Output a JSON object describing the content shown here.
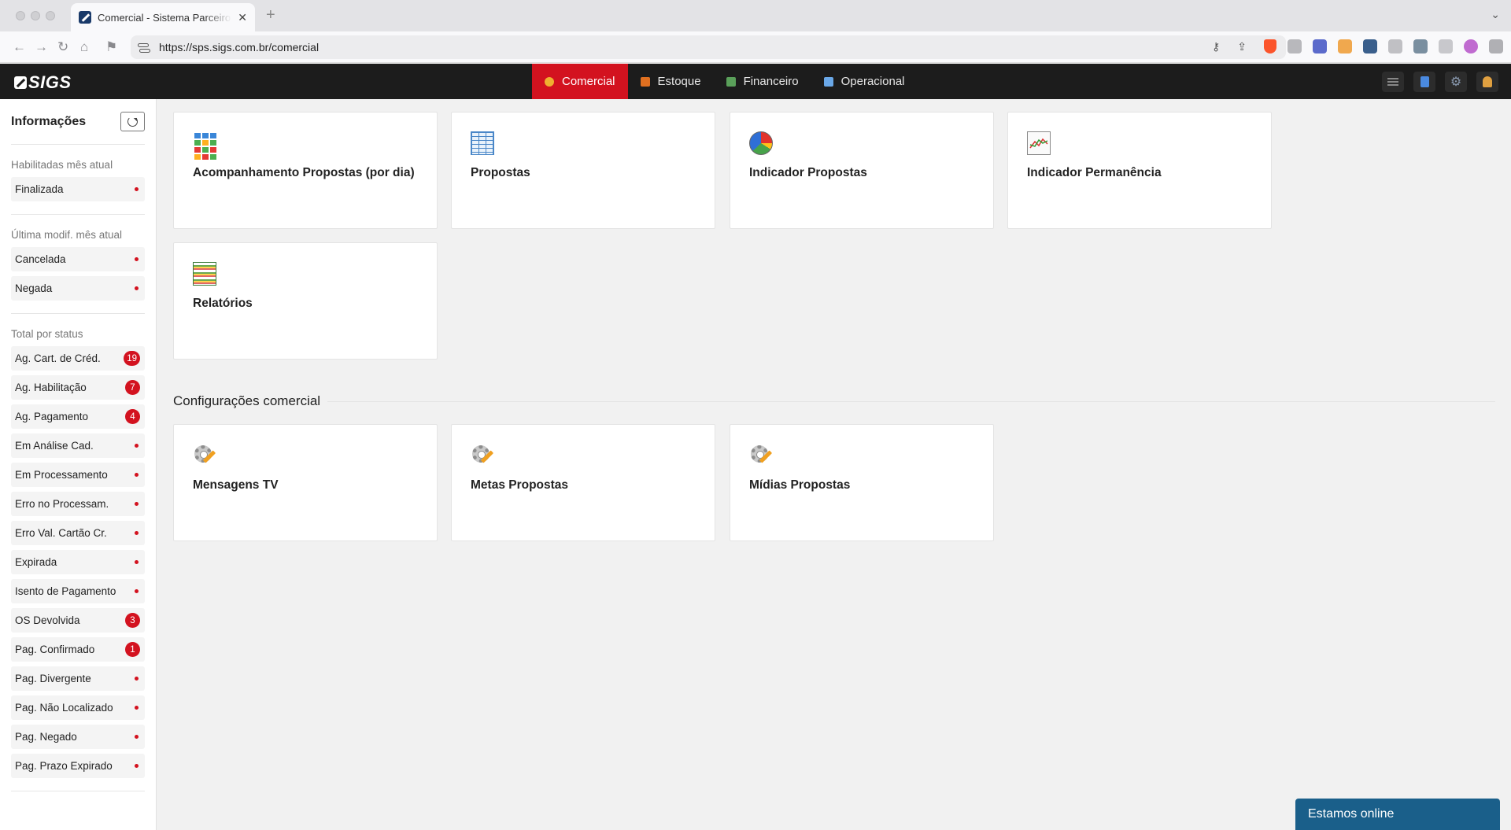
{
  "browser": {
    "tab_title": "Comercial - Sistema Parceiro",
    "tab_close": "✕",
    "new_tab": "+",
    "url": "https://sps.sigs.com.br/comercial"
  },
  "app": {
    "logo_text": "SIGS",
    "nav": [
      {
        "label": "Comercial",
        "active": true,
        "icon": "comercial-icon"
      },
      {
        "label": "Estoque",
        "active": false,
        "icon": "estoque-icon"
      },
      {
        "label": "Financeiro",
        "active": false,
        "icon": "financeiro-icon"
      },
      {
        "label": "Operacional",
        "active": false,
        "icon": "operacional-icon"
      }
    ]
  },
  "sidebar": {
    "title": "Informações",
    "sections": [
      {
        "title": "Habilitadas mês atual",
        "items": [
          {
            "label": "Finalizada",
            "badge": ""
          }
        ]
      },
      {
        "title": "Última modif. mês atual",
        "items": [
          {
            "label": "Cancelada",
            "badge": ""
          },
          {
            "label": "Negada",
            "badge": ""
          }
        ]
      },
      {
        "title": "Total por status",
        "items": [
          {
            "label": "Ag. Cart. de Créd.",
            "badge": "19"
          },
          {
            "label": "Ag. Habilitação",
            "badge": "7"
          },
          {
            "label": "Ag. Pagamento",
            "badge": "4"
          },
          {
            "label": "Em Análise Cad.",
            "badge": ""
          },
          {
            "label": "Em Processamento",
            "badge": ""
          },
          {
            "label": "Erro no Processam.",
            "badge": ""
          },
          {
            "label": "Erro Val. Cartão Cr.",
            "badge": ""
          },
          {
            "label": "Expirada",
            "badge": ""
          },
          {
            "label": "Isento de Pagamento",
            "badge": ""
          },
          {
            "label": "OS Devolvida",
            "badge": "3"
          },
          {
            "label": "Pag. Confirmado",
            "badge": "1"
          },
          {
            "label": "Pag. Divergente",
            "badge": ""
          },
          {
            "label": "Pag. Não Localizado",
            "badge": ""
          },
          {
            "label": "Pag. Negado",
            "badge": ""
          },
          {
            "label": "Pag. Prazo Expirado",
            "badge": ""
          }
        ]
      }
    ]
  },
  "main": {
    "cards": [
      {
        "title": "Acompanhamento Propostas (por dia)",
        "icon": "grid-icon"
      },
      {
        "title": "Propostas",
        "icon": "table-icon"
      },
      {
        "title": "Indicador Propostas",
        "icon": "pie-chart-icon"
      },
      {
        "title": "Indicador Permanência",
        "icon": "line-chart-icon"
      },
      {
        "title": "Relatórios",
        "icon": "report-icon"
      }
    ],
    "config_section_title": "Configurações comercial",
    "config_cards": [
      {
        "title": "Mensagens TV",
        "icon": "settings-icon"
      },
      {
        "title": "Metas Propostas",
        "icon": "settings-icon"
      },
      {
        "title": "Mídias Propostas",
        "icon": "settings-icon"
      }
    ]
  },
  "chat": {
    "label": "Estamos online"
  },
  "colors": {
    "accent": "#d3121f",
    "appbar": "#1c1c1c",
    "chat": "#1a5f8a"
  }
}
